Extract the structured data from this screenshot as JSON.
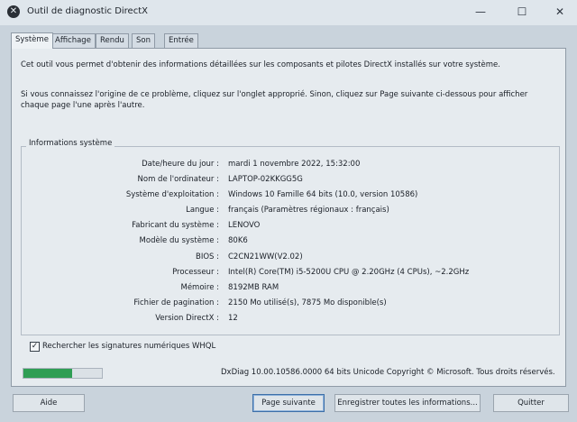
{
  "window": {
    "title": "Outil de diagnostic DirectX",
    "icon": "x-icon",
    "minimize_glyph": "—",
    "maximize_glyph": "☐",
    "close_glyph": "✕"
  },
  "tabs": [
    {
      "label": "Système",
      "active": true
    },
    {
      "label": "Affichage",
      "active": false
    },
    {
      "label": "Rendu",
      "active": false
    },
    {
      "label": "Son",
      "active": false
    },
    {
      "label": "Entrée",
      "active": false
    }
  ],
  "intro": {
    "line1": "Cet outil vous permet d'obtenir des informations détaillées sur les composants et pilotes DirectX installés sur votre système.",
    "line2": "Si vous connaissez l'origine de ce problème, cliquez sur l'onglet approprié. Sinon, cliquez sur Page suivante ci-dessous pour afficher chaque page l'une après l'autre."
  },
  "system_info": {
    "group_title": "Informations système",
    "rows": [
      {
        "label": "Date/heure du jour :",
        "value": "mardi 1 novembre 2022, 15:32:00"
      },
      {
        "label": "Nom de l'ordinateur :",
        "value": "LAPTOP-02KKGG5G"
      },
      {
        "label": "Système d'exploitation :",
        "value": "Windows 10 Famille 64 bits (10.0, version 10586)"
      },
      {
        "label": "Langue :",
        "value": "français (Paramètres régionaux : français)"
      },
      {
        "label": "Fabricant du système :",
        "value": "LENOVO"
      },
      {
        "label": "Modèle du système :",
        "value": "80K6"
      },
      {
        "label": "BIOS :",
        "value": "C2CN21WW(V2.02)"
      },
      {
        "label": "Processeur :",
        "value": "Intel(R) Core(TM) i5-5200U CPU @ 2.20GHz (4 CPUs), ~2.2GHz"
      },
      {
        "label": "Mémoire :",
        "value": "8192MB RAM"
      },
      {
        "label": "Fichier de pagination :",
        "value": "2150 Mo utilisé(s), 7875 Mo disponible(s)"
      },
      {
        "label": "Version DirectX :",
        "value": "12"
      }
    ]
  },
  "whql_checkbox": {
    "label": "Rechercher les signatures numériques WHQL",
    "checked": true,
    "glyph": "✓"
  },
  "progress": {
    "fraction": 0.62,
    "color": "#2f9e54"
  },
  "footer": {
    "copyright": "DxDiag 10.00.10586.0000 64 bits Unicode Copyright © Microsoft. Tous droits réservés."
  },
  "buttons": {
    "help": "Aide",
    "next_page": "Page suivante",
    "save_all": "Enregistrer toutes les informations...",
    "quit": "Quitter"
  }
}
